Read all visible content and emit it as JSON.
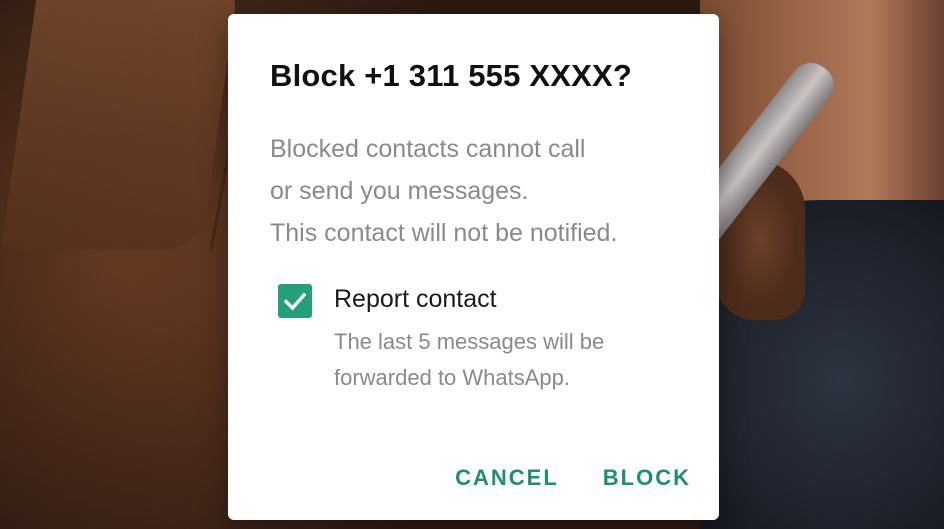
{
  "dialog": {
    "title": "Block +1 311 555 XXXX?",
    "body_lines": [
      "Blocked contacts cannot call",
      "or send you messages.",
      "This contact will not be notified."
    ],
    "report": {
      "checked": true,
      "label": "Report contact",
      "description_lines": [
        "The last 5 messages will be",
        "forwarded to WhatsApp."
      ]
    },
    "actions": {
      "cancel_label": "CANCEL",
      "block_label": "BLOCK"
    }
  },
  "colors": {
    "accent": "#1f8f6c",
    "checkbox": "#23a07a",
    "dialog_bg": "#ffffff",
    "body_text": "#8a8a8a",
    "title_text": "#111111"
  },
  "icons": {
    "checkbox": "check-icon"
  }
}
